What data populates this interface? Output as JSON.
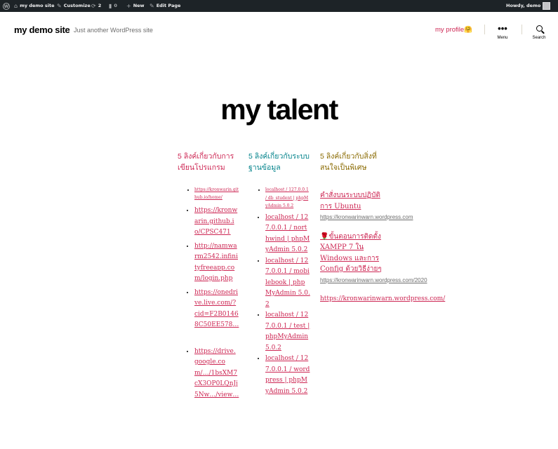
{
  "adminbar": {
    "site_name": "my demo site",
    "customize": "Customize",
    "updates_count": "2",
    "comments_count": "0",
    "new_label": "New",
    "edit_page": "Edit Page",
    "howdy": "Howdy, demo"
  },
  "header": {
    "site_title": "my demo site",
    "tagline": "Just another WordPress site",
    "profile_link": "my profile🤗",
    "menu_label": "Menu",
    "search_label": "Search"
  },
  "page": {
    "title": "my talent"
  },
  "columns": [
    {
      "heading": "5 ลิงค์เกี่ยวกับการเขียนโปรแกรม",
      "heading_color": "#cd2653",
      "links": [
        "https://kronwarin.github.io/home/",
        "https://kronwarin.github.io/CPSC471",
        "http://namwarm2542.infinityfreeapp.com/login.php",
        "https://onedrive.live.com/?cid=F2B01468C50EE578…",
        "https://drive.google.com/…/1bsXM7cX3OP0LQnJj5Nw…/view…"
      ]
    },
    {
      "heading": "5 ลิงค์เกี่ยวกับระบบฐานข้อมูล",
      "heading_color": "#00828a",
      "links": [
        "localhost / 127.0.0.1 / db_student | phpMyAdmin 5.0.2",
        "localhost / 127.0.0.1 / northwind | phpMyAdmin 5.0.2",
        "localhost / 127.0.0.1 / mobilebook | phpMyAdmin 5.0.2",
        "localhost / 127.0.0.1 / test | phpMyAdmin 5.0.2",
        "localhost / 127.0.0.1 / wordpress | phpMyAdmin 5.0.2"
      ]
    },
    {
      "heading": "5 ลิงค์เกี่ยวกับสิ่งที่สนใจเป็นพิเศษ",
      "heading_color": "#8a6a00",
      "items": [
        {
          "title": "คำสั่งบนระบบปฏิบัติการ Ubuntu",
          "url": "https://kronwarinwarn.wordpress.com"
        },
        {
          "title": "🌹ขั้นตอนการติดตั้ง XAMPP 7 ใน Windows และการ Config ด้วยวิธีง่ายๆ",
          "url": "https://kronwarinwarn.wordpress.com/2020"
        }
      ],
      "plain_link": "https://kronwarinwarn.wordpress.com/"
    }
  ]
}
